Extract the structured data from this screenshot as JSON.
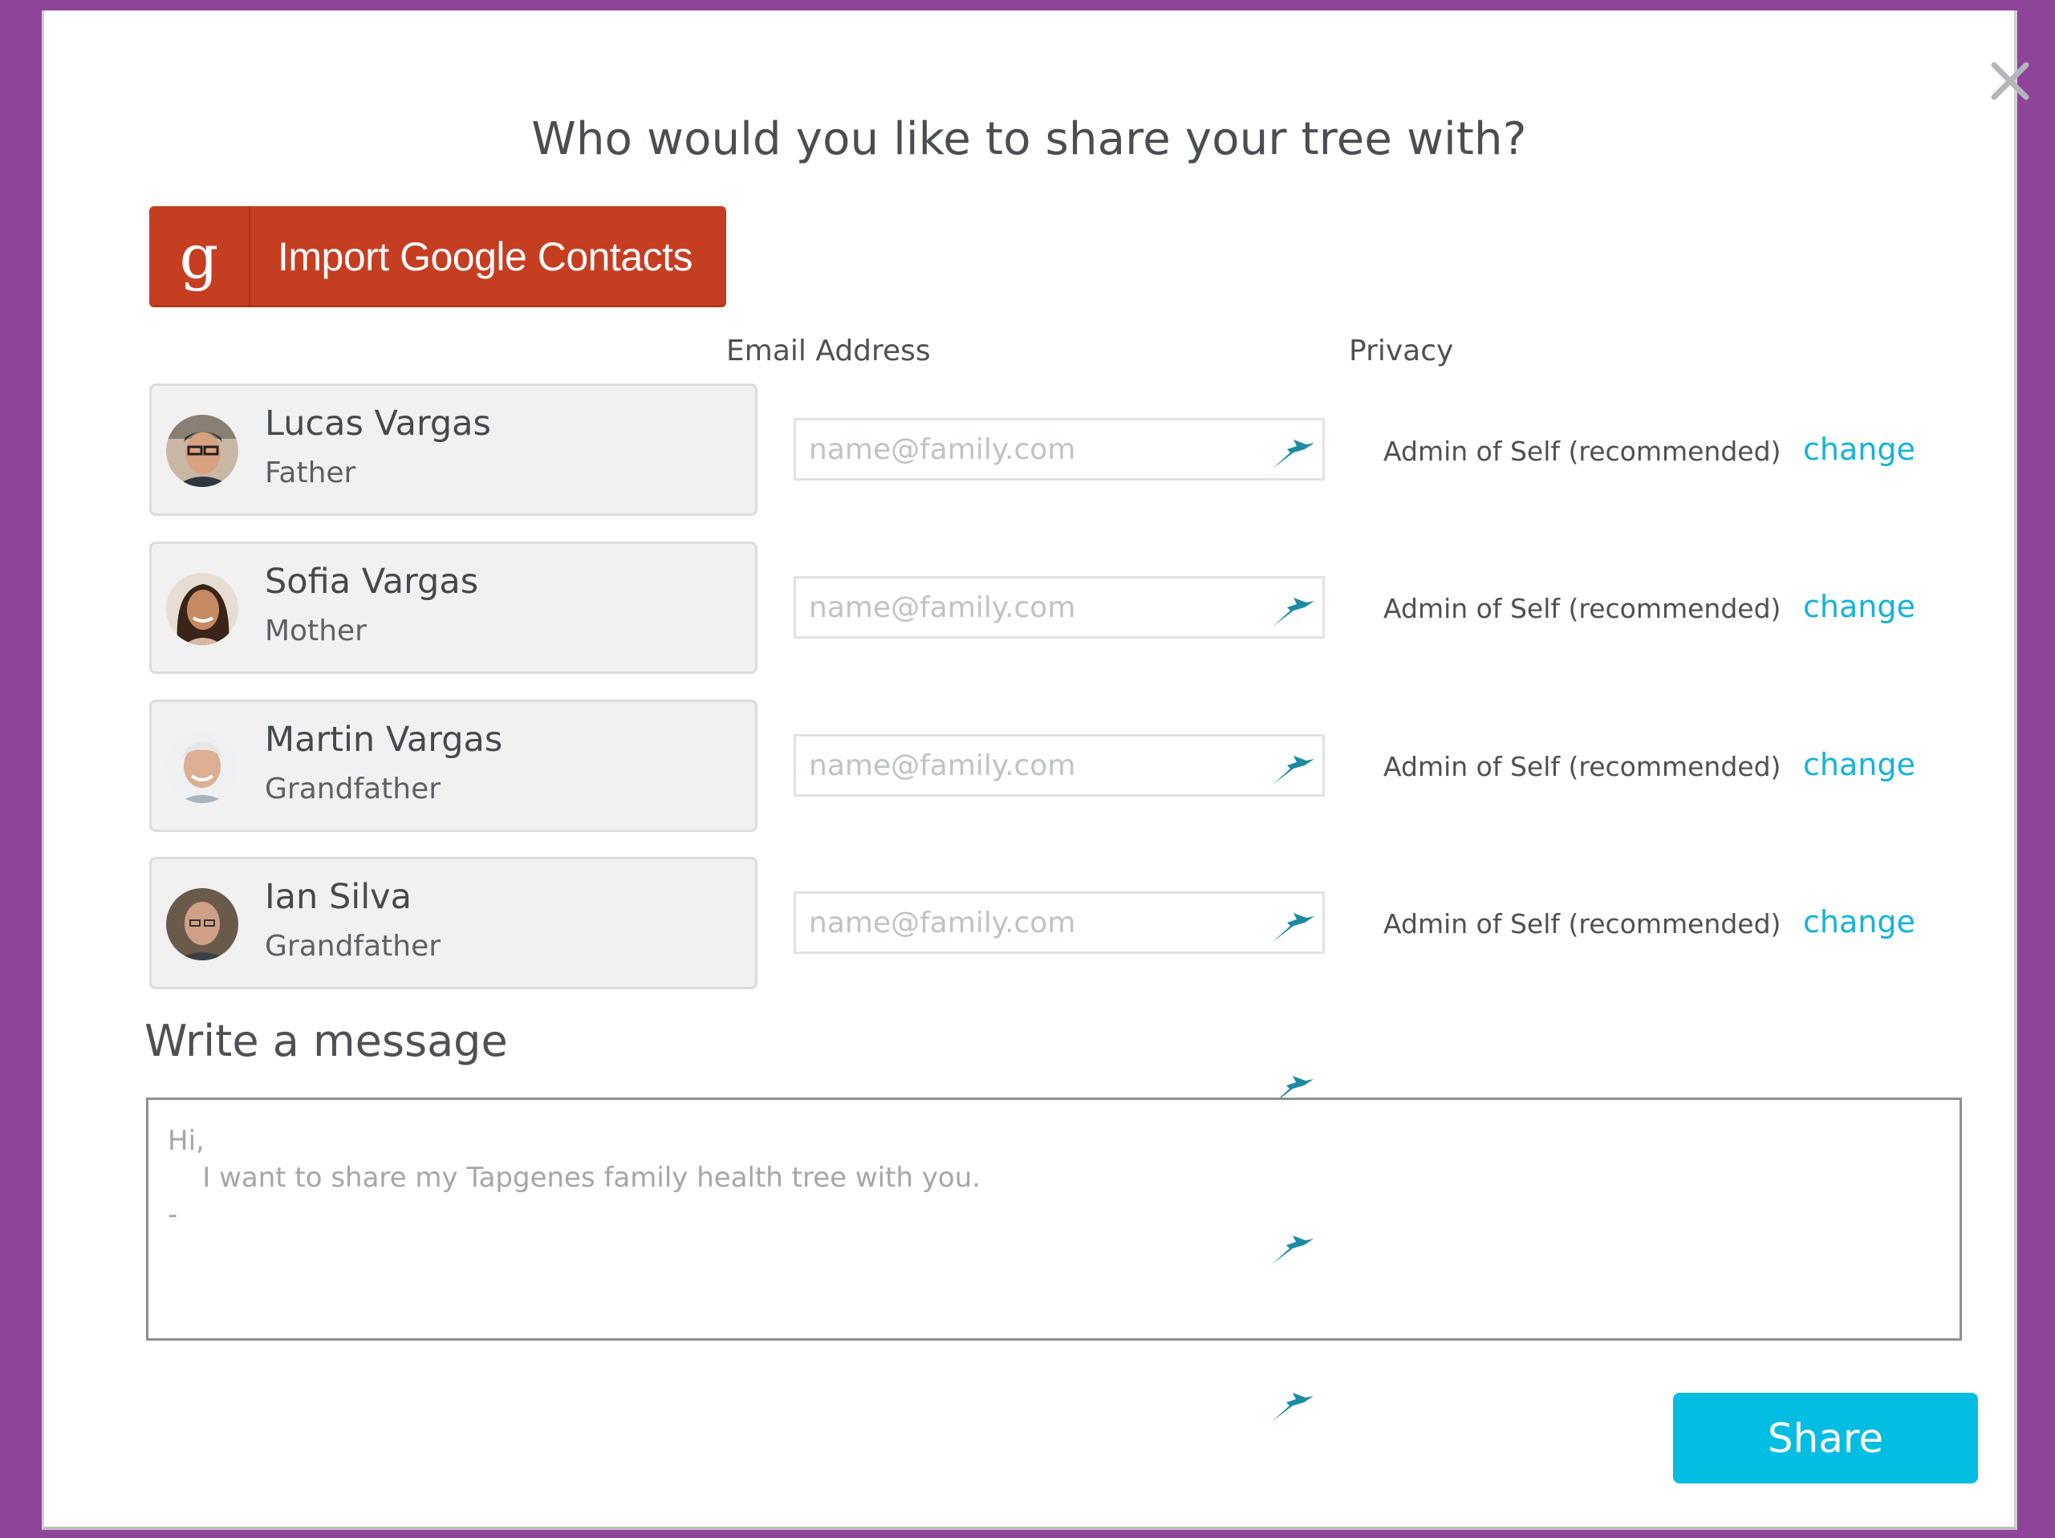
{
  "dialog": {
    "title": "Who would you like to share your tree with?",
    "close_icon": "close-icon"
  },
  "google_button": {
    "icon": "google-g-icon",
    "icon_glyph": "g",
    "label": "Import Google Contacts",
    "color": "#c63e22"
  },
  "columns": {
    "email": "Email Address",
    "privacy": "Privacy"
  },
  "people": [
    {
      "name": "Lucas Vargas",
      "relation": "Father",
      "email_value": "",
      "email_placeholder": "name@family.com",
      "privacy": "Admin of Self (recommended)",
      "change_label": "change"
    },
    {
      "name": "Sofia Vargas",
      "relation": "Mother",
      "email_value": "",
      "email_placeholder": "name@family.com",
      "privacy": "Admin of Self (recommended)",
      "change_label": "change"
    },
    {
      "name": "Martin Vargas",
      "relation": "Grandfather",
      "email_value": "",
      "email_placeholder": "name@family.com",
      "privacy": "Admin of Self (recommended)",
      "change_label": "change"
    },
    {
      "name": "Ian Silva",
      "relation": "Grandfather",
      "email_value": "",
      "email_placeholder": "name@family.com",
      "privacy": "Admin of Self (recommended)",
      "change_label": "change"
    }
  ],
  "message": {
    "label": "Write a message",
    "line1": "Hi,",
    "line2": "    I want to share my Tapgenes family health tree with you.",
    "line3": "-"
  },
  "share_button": {
    "label": "Share",
    "color": "#03bde3"
  },
  "colors": {
    "background": "#8e4499",
    "link": "#14b3d9"
  }
}
